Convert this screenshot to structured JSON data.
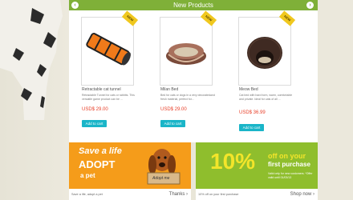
{
  "header": {
    "title": "New Products",
    "prev": "‹",
    "next": "›"
  },
  "products": [
    {
      "name": "Retractable cat tunnel",
      "desc": "Retractable Tunnel for cats or rabbits. This versatile game product can be ...",
      "price": "USD$ 29.00",
      "button": "Add to cart",
      "badge": "NEW"
    },
    {
      "name": "Milan Bed",
      "desc": "Bed for cats or dogs in a very decoratedand fresh material, perfect for...",
      "price": "USD$ 29.00",
      "button": "Add to cart",
      "badge": "NEW"
    },
    {
      "name": "Meow Bed",
      "desc": "Cat bed with hard form, warm, comfortable and private. Ideal for cats of all ...",
      "price": "USD$ 36.99",
      "button": "Add to cart",
      "badge": "NEW"
    }
  ],
  "promo_left": {
    "line1": "Save a life",
    "line2": "ADOPT",
    "line3": "a pet",
    "sign": "Adopt me",
    "footer_text": "Save a life, adopt a pet",
    "footer_button": "Thanks ›"
  },
  "promo_right": {
    "big": "10%",
    "line1": "off on your",
    "line2": "first purchase",
    "small": "Valid only for new customers. *Offer valid until 01/03/13",
    "footer_text": "10% off on your first purchase",
    "footer_button": "Shop now ›"
  },
  "colors": {
    "green": "#7fb038",
    "orange": "#f59c1a",
    "teal": "#1ab5c8",
    "price": "#e8402a"
  }
}
